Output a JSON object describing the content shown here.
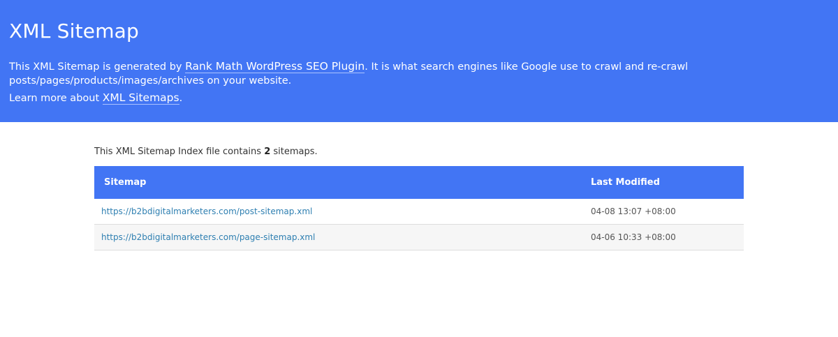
{
  "header": {
    "title": "XML Sitemap",
    "desc_part1": "This XML Sitemap is generated by ",
    "desc_link": "Rank Math WordPress SEO Plugin",
    "desc_part2": ". It is what search engines like Google use to crawl and re-crawl posts/pages/products/images/archives on your website.",
    "learn_prefix": "Learn more about ",
    "learn_link": "XML Sitemaps",
    "learn_suffix": "."
  },
  "intro": {
    "prefix": "This XML Sitemap Index file contains ",
    "count": "2",
    "suffix": " sitemaps."
  },
  "table": {
    "headers": {
      "sitemap": "Sitemap",
      "modified": "Last Modified"
    },
    "rows": [
      {
        "url": "https://b2bdigitalmarketers.com/post-sitemap.xml",
        "modified": "04-08 13:07 +08:00"
      },
      {
        "url": "https://b2bdigitalmarketers.com/page-sitemap.xml",
        "modified": "04-06 10:33 +08:00"
      }
    ]
  },
  "colors": {
    "accent": "#4275f4",
    "link": "#2e7fb1"
  }
}
